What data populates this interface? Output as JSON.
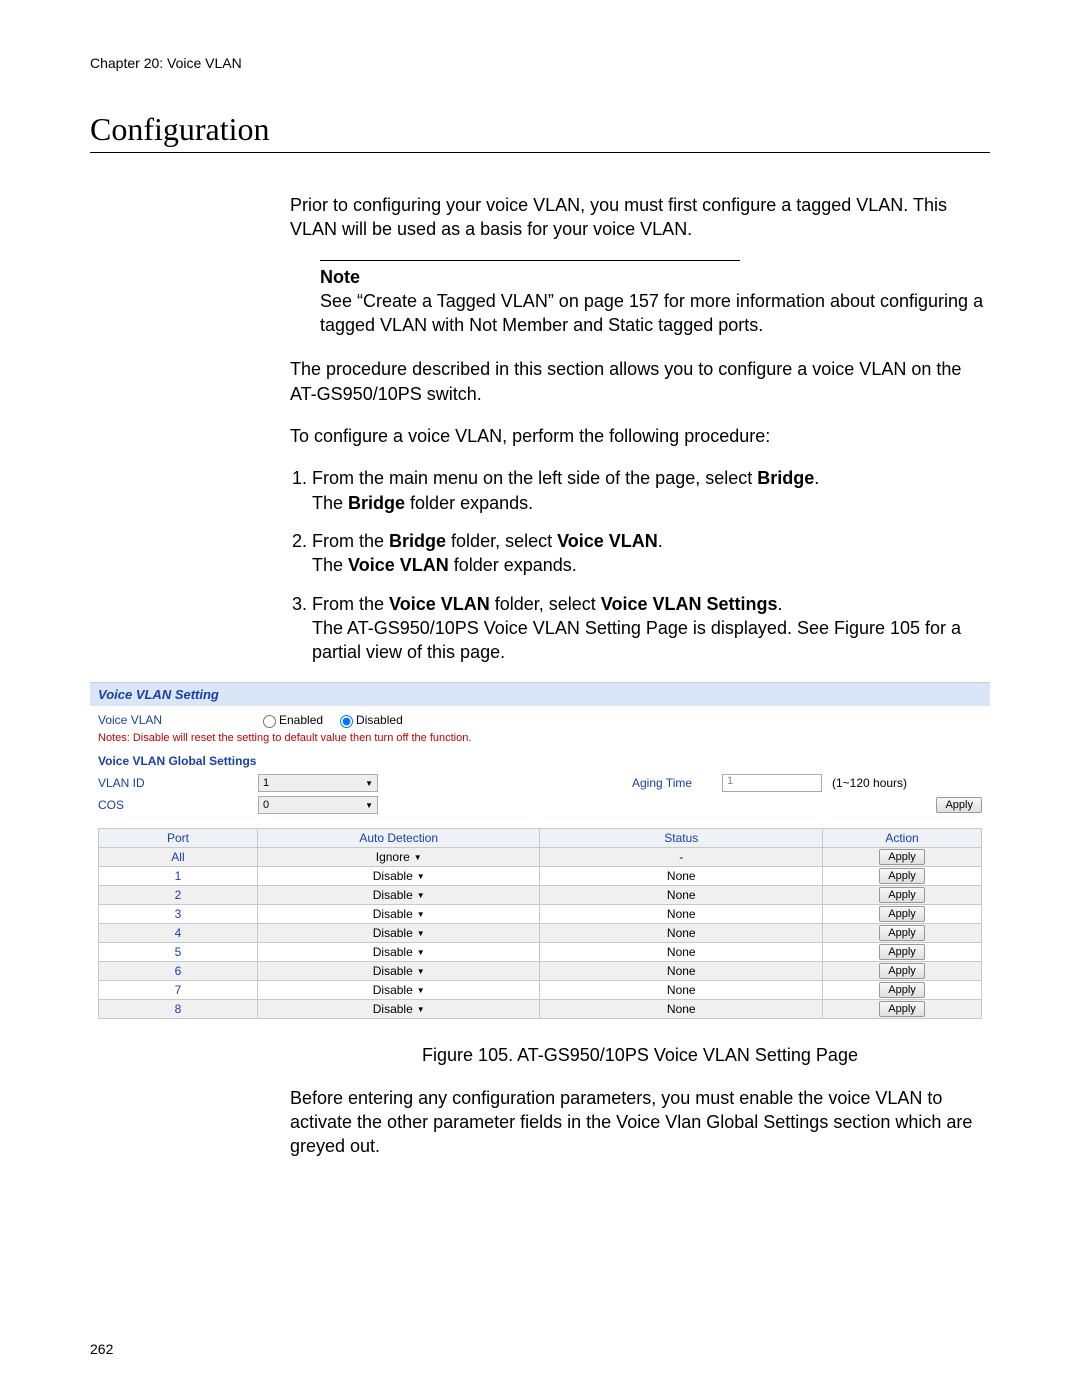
{
  "chapter": "Chapter 20: Voice VLAN",
  "section_title": "Configuration",
  "intro_para": "Prior to configuring your voice VLAN, you must first configure a tagged VLAN. This VLAN will be used as a basis for your voice VLAN.",
  "note": {
    "label": "Note",
    "text": "See “Create a Tagged VLAN” on page 157 for more information about configuring a tagged VLAN with Not Member and Static tagged ports."
  },
  "para2": "The procedure described in this section allows you to configure a voice VLAN on the AT-GS950/10PS switch.",
  "para3": "To configure a voice VLAN, perform the following procedure:",
  "steps": {
    "s1a": "From the main menu on the left side of the page, select ",
    "s1b": "Bridge",
    "s1c": ".",
    "s1d": "The ",
    "s1e": "Bridge",
    "s1f": " folder expands.",
    "s2a": "From the ",
    "s2b": "Bridge",
    "s2c": " folder, select ",
    "s2d": "Voice VLAN",
    "s2e": ".",
    "s2f": "The ",
    "s2g": "Voice VLAN",
    "s2h": " folder expands.",
    "s3a": "From the ",
    "s3b": "Voice VLAN",
    "s3c": " folder, select ",
    "s3d": "Voice VLAN Settings",
    "s3e": ".",
    "s3f": "The AT-GS950/10PS Voice VLAN Setting Page is displayed. See Figure 105 for a partial view of this page."
  },
  "figure": {
    "panel_title": "Voice VLAN Setting",
    "voice_vlan_label": "Voice VLAN",
    "enabled_label": "Enabled",
    "disabled_label": "Disabled",
    "warning": "Notes: Disable will reset the setting to default value then turn off the function.",
    "global_title": "Voice VLAN Global Settings",
    "vlan_id_label": "VLAN ID",
    "vlan_id_value": "1",
    "aging_label": "Aging Time",
    "aging_value": "1",
    "aging_hint": "(1~120 hours)",
    "cos_label": "COS",
    "cos_value": "0",
    "apply_label": "Apply",
    "table": {
      "headers": {
        "port": "Port",
        "auto": "Auto Detection",
        "status": "Status",
        "action": "Action"
      },
      "rows": [
        {
          "port": "All",
          "auto": "Ignore",
          "status": "-",
          "action": "Apply"
        },
        {
          "port": "1",
          "auto": "Disable",
          "status": "None",
          "action": "Apply"
        },
        {
          "port": "2",
          "auto": "Disable",
          "status": "None",
          "action": "Apply"
        },
        {
          "port": "3",
          "auto": "Disable",
          "status": "None",
          "action": "Apply"
        },
        {
          "port": "4",
          "auto": "Disable",
          "status": "None",
          "action": "Apply"
        },
        {
          "port": "5",
          "auto": "Disable",
          "status": "None",
          "action": "Apply"
        },
        {
          "port": "6",
          "auto": "Disable",
          "status": "None",
          "action": "Apply"
        },
        {
          "port": "7",
          "auto": "Disable",
          "status": "None",
          "action": "Apply"
        },
        {
          "port": "8",
          "auto": "Disable",
          "status": "None",
          "action": "Apply"
        }
      ]
    },
    "caption": "Figure 105. AT-GS950/10PS Voice VLAN Setting Page"
  },
  "closing_para": "Before entering any configuration parameters, you must enable the voice VLAN to activate the other parameter fields in the Voice Vlan Global Settings section which are greyed out.",
  "page_number": "262"
}
